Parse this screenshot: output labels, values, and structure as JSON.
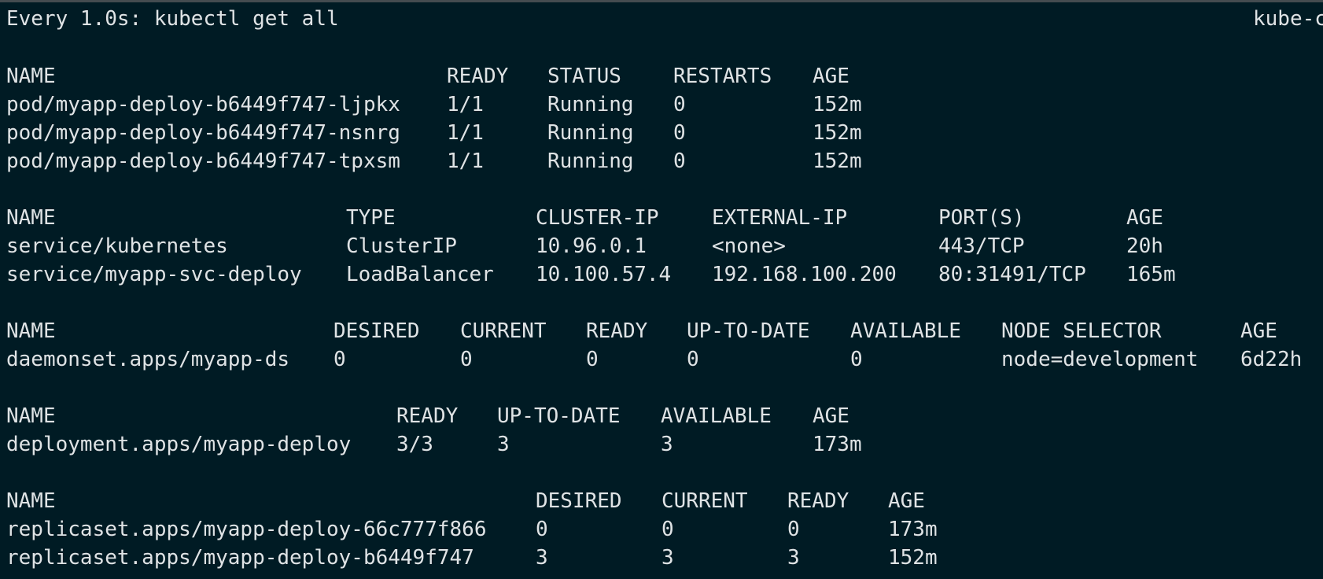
{
  "header": {
    "command": "Every 1.0s: kubectl get all",
    "host": "kube-c"
  },
  "tables": [
    {
      "name": "pods",
      "headers": [
        "NAME",
        "READY",
        "STATUS",
        "RESTARTS",
        "AGE"
      ],
      "rows": [
        [
          "pod/myapp-deploy-b6449f747-ljpkx",
          "1/1",
          "Running",
          "0",
          "152m"
        ],
        [
          "pod/myapp-deploy-b6449f747-nsnrg",
          "1/1",
          "Running",
          "0",
          "152m"
        ],
        [
          "pod/myapp-deploy-b6449f747-tpxsm",
          "1/1",
          "Running",
          "0",
          "152m"
        ]
      ]
    },
    {
      "name": "services",
      "headers": [
        "NAME",
        "TYPE",
        "CLUSTER-IP",
        "EXTERNAL-IP",
        "PORT(S)",
        "AGE"
      ],
      "rows": [
        [
          "service/kubernetes",
          "ClusterIP",
          "10.96.0.1",
          "<none>",
          "443/TCP",
          "20h"
        ],
        [
          "service/myapp-svc-deploy",
          "LoadBalancer",
          "10.100.57.4",
          "192.168.100.200",
          "80:31491/TCP",
          "165m"
        ]
      ]
    },
    {
      "name": "daemonsets",
      "headers": [
        "NAME",
        "DESIRED",
        "CURRENT",
        "READY",
        "UP-TO-DATE",
        "AVAILABLE",
        "NODE SELECTOR",
        "AGE"
      ],
      "rows": [
        [
          "daemonset.apps/myapp-ds",
          "0",
          "0",
          "0",
          "0",
          "0",
          "node=development",
          "6d22h"
        ]
      ]
    },
    {
      "name": "deployments",
      "headers": [
        "NAME",
        "READY",
        "UP-TO-DATE",
        "AVAILABLE",
        "AGE"
      ],
      "rows": [
        [
          "deployment.apps/myapp-deploy",
          "3/3",
          "3",
          "3",
          "173m"
        ]
      ]
    },
    {
      "name": "replicasets",
      "headers": [
        "NAME",
        "DESIRED",
        "CURRENT",
        "READY",
        "AGE"
      ],
      "rows": [
        [
          "replicaset.apps/myapp-deploy-66c777f866",
          "0",
          "0",
          "0",
          "173m"
        ],
        [
          "replicaset.apps/myapp-deploy-b6449f747",
          "3",
          "3",
          "3",
          "152m"
        ]
      ]
    }
  ]
}
